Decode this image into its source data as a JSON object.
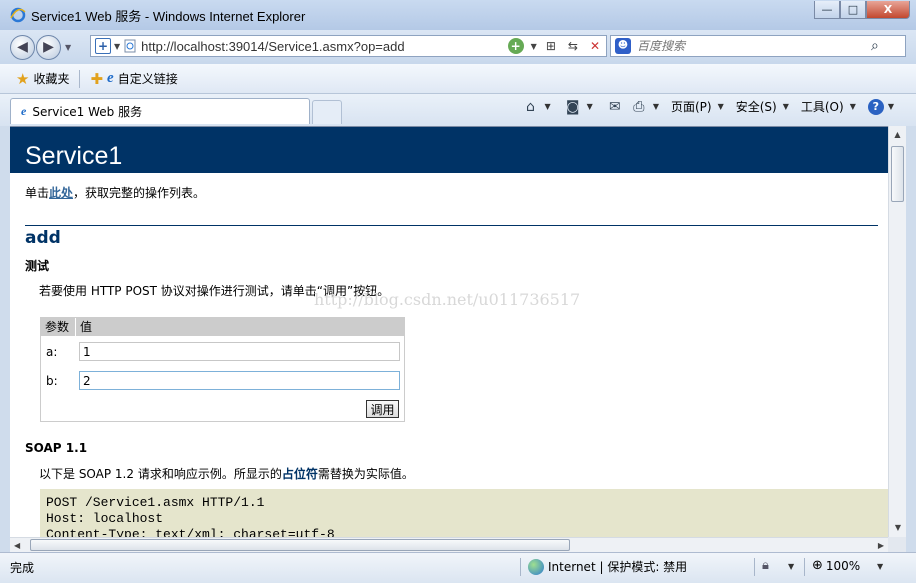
{
  "window": {
    "title": "Service1 Web 服务 - Windows Internet Explorer",
    "minimize_glyph": "—",
    "maximize_glyph": "□",
    "close_glyph": "X"
  },
  "nav": {
    "url": "http://localhost:39014/Service1.asmx?op=add",
    "search_placeholder": "百度搜索",
    "back_glyph": "◀",
    "forward_glyph": "▶"
  },
  "favorites": {
    "label": "收藏夹",
    "custom_links": "自定义链接"
  },
  "tab": {
    "label": "Service1 Web 服务"
  },
  "commands": {
    "page": "页面(P)",
    "safety": "安全(S)",
    "tools": "工具(O)"
  },
  "page": {
    "banner": "Service1",
    "intro_before": "单击",
    "intro_link": "此处",
    "intro_after": "，获取完整的操作列表。",
    "op_title": "add",
    "test_heading": "测试",
    "test_text": "若要使用 HTTP POST 协议对操作进行测试，请单击“调用”按钮。",
    "watermark": "http://blog.csdn.net/u011736517",
    "form": {
      "col_param": "参数",
      "col_value": "值",
      "rows": [
        {
          "label": "a:",
          "value": "1"
        },
        {
          "label": "b:",
          "value": "2"
        }
      ],
      "invoke": "调用"
    },
    "soap_heading": "SOAP 1.1",
    "soap_text_before": "以下是 SOAP 1.2 请求和响应示例。所显示的",
    "soap_placeholder": "占位符",
    "soap_text_after": "需替换为实际值。",
    "code_lines": [
      "POST /Service1.asmx HTTP/1.1",
      "Host: localhost",
      "Content-Type: text/xml; charset=utf-8"
    ]
  },
  "status": {
    "text": "完成",
    "zone": "Internet | 保护模式: 禁用",
    "zoom": "100%"
  }
}
